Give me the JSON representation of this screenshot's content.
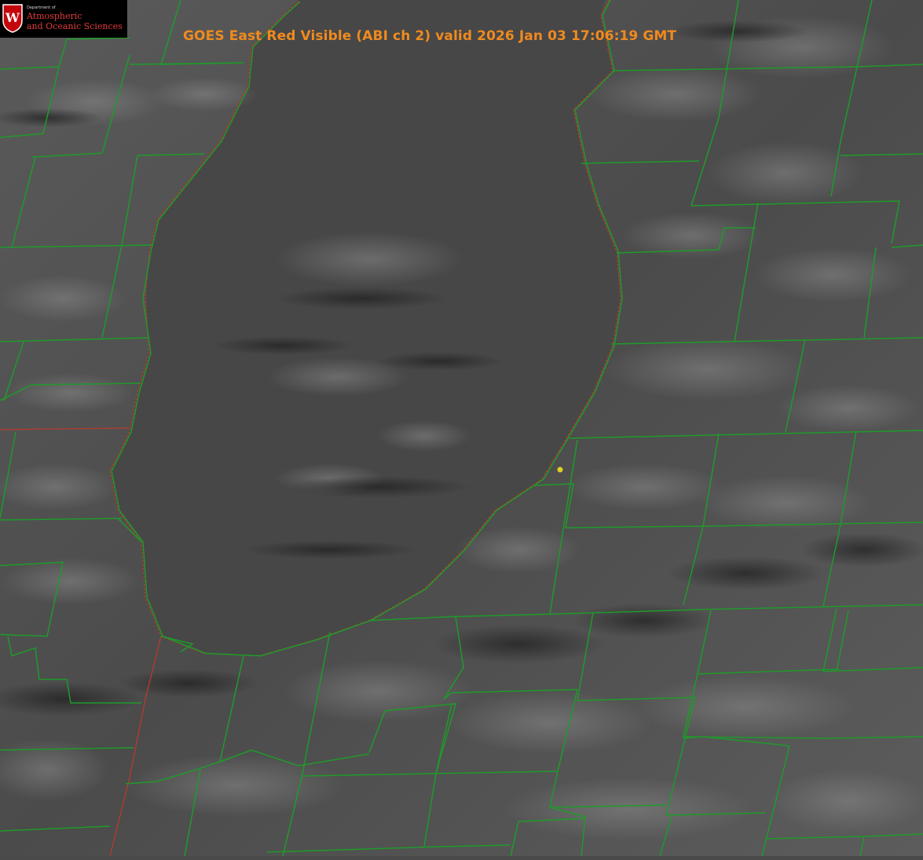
{
  "map": {
    "title": "GOES East Red Visible (ABI ch 2) valid 2026 Jan 03 17:06:19 GMT",
    "satellite": "GOES East",
    "band": "Red Visible (ABI ch 2)",
    "valid_time": "2026 Jan 03 17:06:19 GMT",
    "background": "grayscale visible cloud imagery",
    "marker": {
      "name": "location-marker",
      "color": "#e0d020"
    }
  },
  "logo": {
    "dept_small": "Department of",
    "line1": "Atmospheric",
    "line2": "and Oceanic Sciences",
    "crest_letter": "W",
    "crest_color": "#c5050c"
  },
  "colors": {
    "county_lines": "#1f9a2a",
    "state_line": "#c0392b",
    "title_text": "#f08a1e"
  }
}
